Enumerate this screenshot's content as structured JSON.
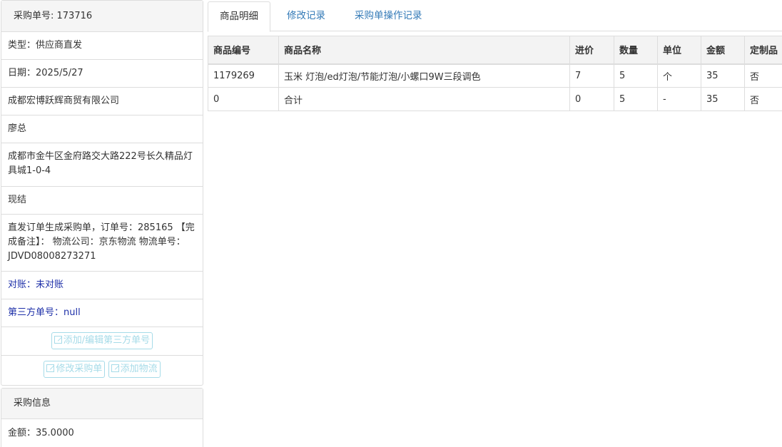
{
  "order": {
    "header": "采购单号: 173716",
    "type": "类型：供应商直发",
    "date": "日期：2025/5/27",
    "company": "成都宏博跃辉商贸有限公司",
    "contact": "廖总",
    "address": "成都市金牛区金府路交大路222号长久精品灯具城1-0-4",
    "payment": "现结",
    "remark": "直发订单生成采购单，订单号：285165 【完成备注】： 物流公司：京东物流 物流单号：JDVD08008273271",
    "reconcile": "对账：未对账",
    "third_party": "第三方单号：null",
    "btn_edit_third": "添加/编辑第三方单号",
    "btn_edit_order": "修改采购单",
    "btn_add_logistics": "添加物流"
  },
  "purchase_info": {
    "header": "采购信息",
    "amount": "金额：35.0000"
  },
  "tabs": [
    "商品明细",
    "修改记录",
    "采购单操作记录"
  ],
  "table": {
    "headers": [
      "商品编号",
      "商品名称",
      "进价",
      "数量",
      "单位",
      "金额",
      "定制品"
    ],
    "rows": [
      [
        "1179269",
        "玉米 灯泡/ed灯泡/节能灯泡/小螺口9W三段调色",
        "7",
        "5",
        "个",
        "35",
        "否"
      ],
      [
        "0",
        "合计",
        "0",
        "5",
        "-",
        "35",
        "否"
      ]
    ]
  }
}
